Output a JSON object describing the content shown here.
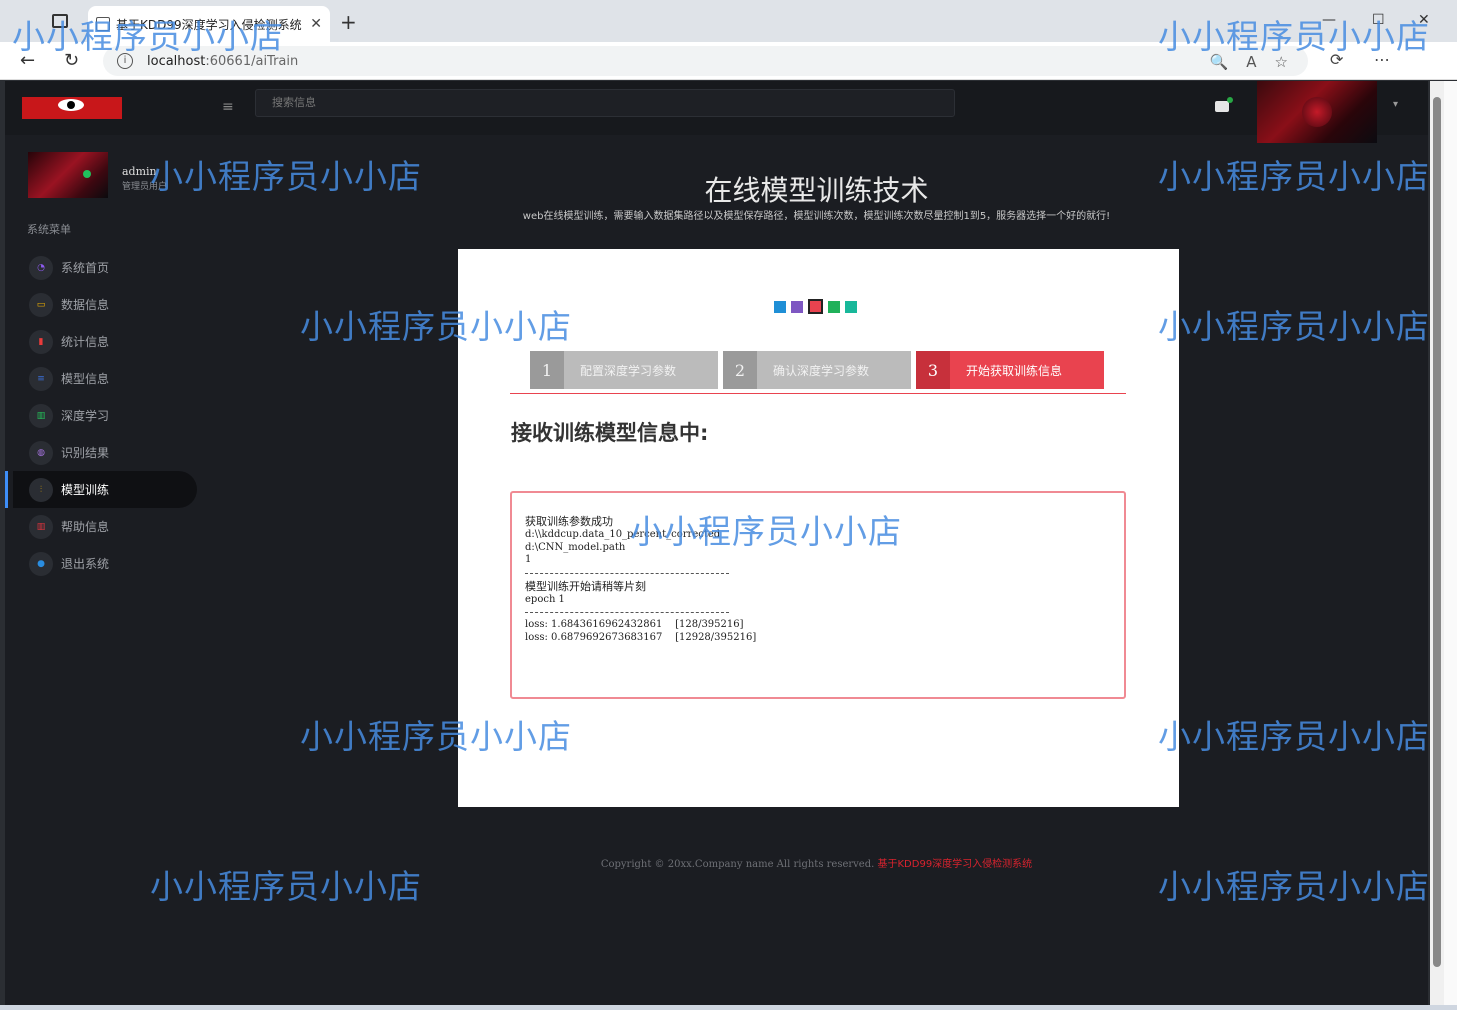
{
  "browser": {
    "tab_title": "基于KDD99深度学习入侵检测系统",
    "tab_close": "✕",
    "new_tab": "+",
    "url_host": "localhost",
    "url_rest": ":60661/aiTrain",
    "info_icon": "i",
    "back": "←",
    "reload": "↻",
    "actions": [
      "🔍",
      "A",
      "☆",
      "⟳",
      "⋯"
    ],
    "window_controls": [
      "—",
      "☐",
      "✕"
    ]
  },
  "app": {
    "search_placeholder": "搜索信息",
    "hamburger": "≡",
    "caret": "▾",
    "user": {
      "name": "admin",
      "role": "管理员用户"
    },
    "menu_title": "系统菜单",
    "menu": [
      {
        "label": "系统首页",
        "icon": "gauge-icon",
        "color": "#8e5bf0"
      },
      {
        "label": "数据信息",
        "icon": "monitor-icon",
        "color": "#f2b200"
      },
      {
        "label": "统计信息",
        "icon": "bar-chart-icon",
        "color": "#ea3b3b"
      },
      {
        "label": "模型信息",
        "icon": "layers-icon",
        "color": "#3a6fd8"
      },
      {
        "label": "深度学习",
        "icon": "grid-icon",
        "color": "#25c05a"
      },
      {
        "label": "识别结果",
        "icon": "mouse-icon",
        "color": "#a774e0"
      },
      {
        "label": "模型训练",
        "icon": "sliders-icon",
        "color": "#f2b200"
      },
      {
        "label": "帮助信息",
        "icon": "book-icon",
        "color": "#e0343d"
      },
      {
        "label": "退出系统",
        "icon": "globe-icon",
        "color": "#2a8de0"
      }
    ],
    "active_menu": 6
  },
  "page": {
    "title": "在线模型训练技术",
    "subtitle": "web在线模型训练，需要输入数据集路径以及模型保存路径，模型训练次数，模型训练次数尽量控制1到5，服务器选择一个好的就行!",
    "dots": [
      "#1f8fd6",
      "#7e57c2",
      "#e9434f",
      "#20b15a",
      "#18b89a"
    ],
    "steps": [
      {
        "num": "1",
        "label": "配置深度学习参数"
      },
      {
        "num": "2",
        "label": "确认深度学习参数"
      },
      {
        "num": "3",
        "label": "开始获取训练信息"
      }
    ],
    "active_step": 2,
    "receive_title": "接收训练模型信息中:",
    "log": {
      "success": "获取训练参数成功",
      "dataset_path": "d:\\\\kddcup.data_10_percent_corrected",
      "model_path": "d:\\CNN_model.path",
      "epochs": "1",
      "start_msg": "模型训练开始请稍等片刻",
      "epoch": "epoch 1",
      "loss1": "loss: 1.6843616962432861    [128/395216]",
      "loss2": "loss: 0.6879692673683167    [12928/395216]"
    },
    "footer_copy": "Copyright © 20xx.Company name All rights reserved.",
    "footer_link": "基于KDD99深度学习入侵检测系统"
  },
  "watermark": "小小程序员小小店"
}
